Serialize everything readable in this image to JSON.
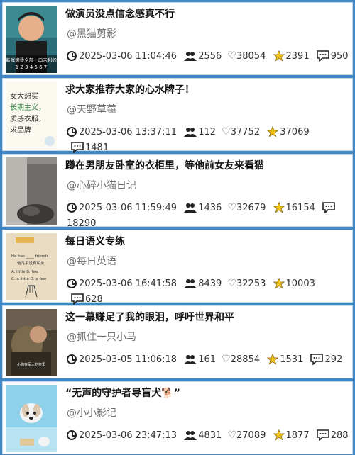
{
  "items": [
    {
      "title": "做演员没点信念感真不行",
      "author": "@黑猫剪影",
      "date": "2025-03-06 11:04:46",
      "users": "2556",
      "likes": "38054",
      "stars": "2391",
      "comments": "950",
      "thumb_text": "新鲜滚烫全部一口吉利的 1234567"
    },
    {
      "title": "求大家推荐大家的心水牌子！",
      "author": "@天野草莓",
      "date": "2025-03-06 13:37:11",
      "users": "112",
      "likes": "37752",
      "stars": "37069",
      "comments": "1481",
      "thumb_text": "女大想买 长期主义， 质感衣服， 求品牌"
    },
    {
      "title": "蹲在男朋友卧室的衣柜里，等他前女友来看猫",
      "author": "@心碎小猫日记",
      "date": "2025-03-06 11:59:49",
      "users": "1436",
      "likes": "32679",
      "stars": "16154",
      "comments": "18290",
      "thumb_text": ""
    },
    {
      "title": "每日语义专练",
      "author": "@每日英语",
      "date": "2025-03-06 16:41:58",
      "users": "8439",
      "likes": "32253",
      "stars": "10003",
      "comments": "628",
      "thumb_text": "He has ____ friends. 他几乎没有朋友 A. little B. few C. a little D. a few"
    },
    {
      "title": "这一幕赚足了我的眼泪，呼吁世界和平",
      "author": "@抓住一只小马",
      "date": "2025-03-05 11:06:18",
      "users": "161",
      "likes": "28854",
      "stars": "1531",
      "comments": "292",
      "thumb_text": ""
    },
    {
      "title": "“无声的守护者导盲犬🐕”",
      "author": "@小小影记",
      "date": "2025-03-06 23:47:13",
      "users": "4831",
      "likes": "27089",
      "stars": "1877",
      "comments": "288",
      "thumb_text": ""
    }
  ],
  "colors": {
    "background": "#3e86c6",
    "card": "#ffffff",
    "star": "#f5c518"
  },
  "icons": {
    "clock": "clock-icon",
    "users": "users-icon",
    "heart": "heart-icon",
    "star": "star-icon",
    "comment": "comment-icon"
  }
}
